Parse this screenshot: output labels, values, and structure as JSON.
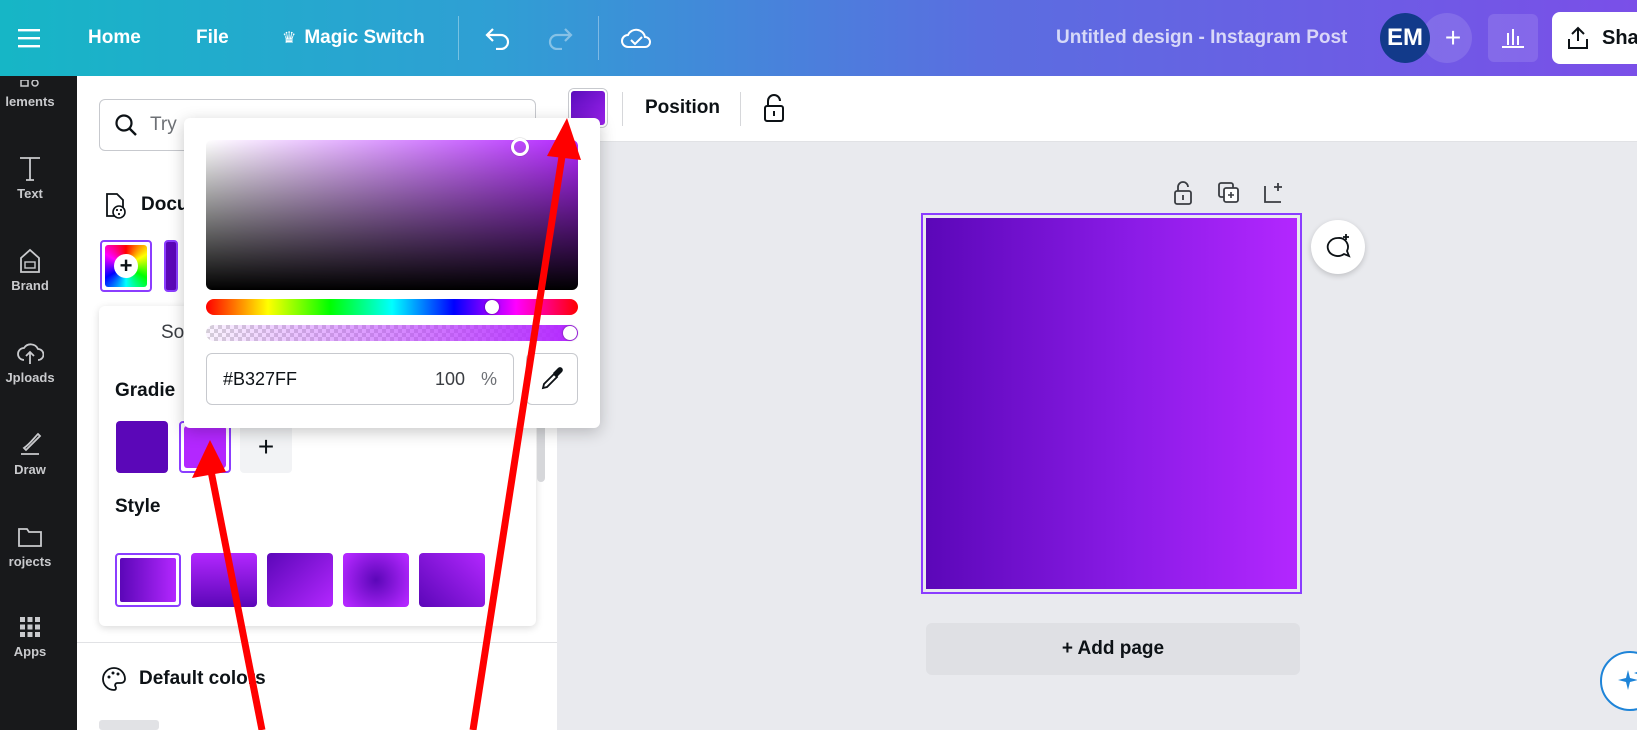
{
  "topbar": {
    "menu_icon": "hamburger-icon",
    "home": "Home",
    "file": "File",
    "magic_switch": "Magic Switch",
    "magic_icon": "crown-icon",
    "title": "Untitled design - Instagram Post",
    "avatar": "EM",
    "add_collaborator": "+",
    "share": "Sha"
  },
  "rail": {
    "items": [
      {
        "label": "lements",
        "icon": "elements-icon"
      },
      {
        "label": "Text",
        "icon": "text-icon"
      },
      {
        "label": "Brand",
        "icon": "brand-icon"
      },
      {
        "label": "Jploads",
        "icon": "upload-icon"
      },
      {
        "label": "Draw",
        "icon": "draw-icon"
      },
      {
        "label": "rojects",
        "icon": "folder-icon"
      },
      {
        "label": "Apps",
        "icon": "apps-icon"
      }
    ]
  },
  "panel": {
    "search_placeholder": "Try",
    "document_colors": "Docu",
    "solid_tab": "So",
    "gradient_label": "Gradie",
    "add_stop": "+",
    "style_label": "Style",
    "default_colors": "Default colors"
  },
  "context_toolbar": {
    "position": "Position"
  },
  "picker": {
    "hex": "#B327FF",
    "opacity": "100",
    "percent": "%"
  },
  "canvas": {
    "add_page": "+ Add page"
  },
  "colors": {
    "accent": "#8B3DFF",
    "gradient_start": "#5B07B8",
    "gradient_end": "#B327FF",
    "annotation_arrow": "#FF0000"
  }
}
